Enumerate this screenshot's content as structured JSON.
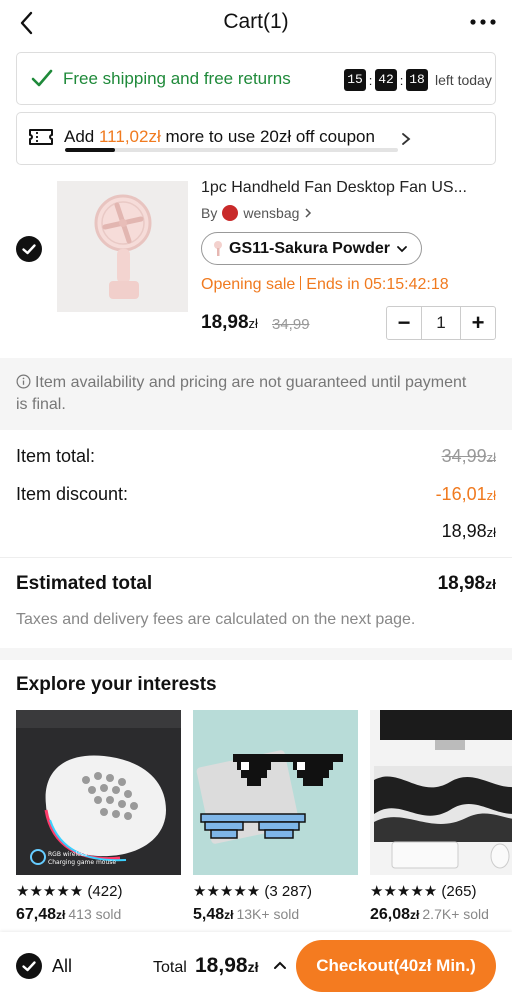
{
  "header": {
    "title": "Cart(1)"
  },
  "shipping_banner": {
    "text": "Free shipping and free returns",
    "timer": [
      "15",
      "42",
      "18"
    ],
    "suffix": "left today"
  },
  "coupon_banner": {
    "prefix": "Add ",
    "amount": "111,02zł",
    "suffix": " more to use 20zł off coupon",
    "progress_fraction": 0.15
  },
  "product": {
    "name": "1pc Handheld Fan Desktop Fan US...",
    "by_label": "By",
    "store": "wensbag",
    "variant": "GS11-Sakura Powder",
    "sale_label": "Opening sale",
    "ends_label": "Ends in 05:15:42:18",
    "price_main": "18,98",
    "price_currency": "zł",
    "old_price": "34,99",
    "quantity": "1",
    "minus": "−",
    "plus": "+"
  },
  "notice": "Item availability and pricing are not guaranteed until payment is final.",
  "totals": {
    "item_total_label": "Item total:",
    "item_total_value": "34,99",
    "item_discount_label": "Item discount:",
    "item_discount_value": "-16,01",
    "subtotal_value": "18,98",
    "currency": "zł",
    "estimated_label": "Estimated total",
    "estimated_value": "18,98",
    "tax_note": "Taxes and delivery fees are calculated on the next page."
  },
  "explore": {
    "title": "Explore your interests",
    "items": [
      {
        "stars": "★★★★★",
        "reviews": "(422)",
        "price": "67,48",
        "currency": "zł",
        "sold": "413 sold",
        "image_caption_1": "RGB wireless",
        "image_caption_2": "Charging game mouse"
      },
      {
        "stars": "★★★★★",
        "reviews": "(3 287)",
        "price": "5,48",
        "currency": "zł",
        "sold": "13K+ sold"
      },
      {
        "stars": "★★★★★",
        "reviews": "(265)",
        "price": "26,08",
        "currency": "zł",
        "sold": "2.7K+ sold"
      }
    ]
  },
  "bottom_bar": {
    "all_label": "All",
    "total_label": "Total",
    "total_value": "18,98",
    "currency": "zł",
    "checkout_label": "Checkout(40zł Min.)"
  },
  "colors": {
    "accent": "#f47b20",
    "sale_orange": "#f07a1f",
    "success_green": "#1f8a3a"
  }
}
